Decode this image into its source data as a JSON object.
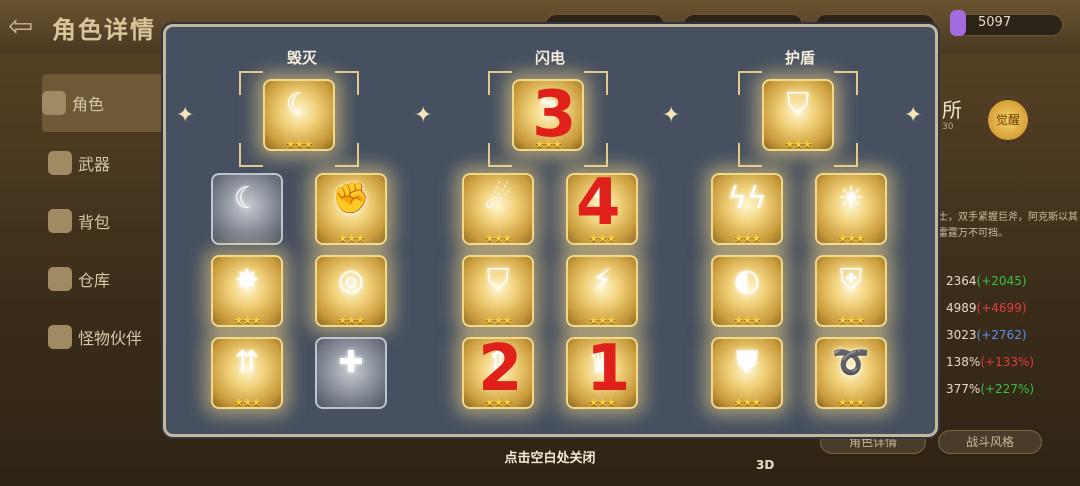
{
  "header": {
    "back_icon": "back-arrow-icon",
    "title": "角色详情",
    "gem_count": "5097"
  },
  "sidebar": {
    "items": [
      {
        "label": "角色",
        "icon": "character-icon"
      },
      {
        "label": "武器",
        "icon": "sword-icon"
      },
      {
        "label": "背包",
        "icon": "bag-icon"
      },
      {
        "label": "仓库",
        "icon": "warehouse-icon"
      },
      {
        "label": "怪物伙伴",
        "icon": "monster-icon"
      }
    ]
  },
  "right_panel": {
    "title_fragment": "所",
    "badge": "觉醒",
    "level_fragment": "30",
    "desc": "士，双手紧握巨斧，阿克斯以其雷霆万不可挡。",
    "stats": [
      {
        "base": "2364",
        "delta": "(+2045)",
        "tone": "plus"
      },
      {
        "base": "4989",
        "delta": "(+4699)",
        "tone": "minus"
      },
      {
        "base": "3023",
        "delta": "(+2762)",
        "tone": "blue"
      },
      {
        "base": "138%",
        "delta": "(+133%)",
        "tone": "minus"
      },
      {
        "base": "377%",
        "delta": "(+227%)",
        "tone": "plus"
      }
    ],
    "btn_details": "角色详情",
    "btn_style": "战斗风格",
    "label_3d": "3D"
  },
  "modal": {
    "columns": [
      {
        "title": "毁灭",
        "big_stars": "★★★"
      },
      {
        "title": "闪电",
        "big_stars": "★★★"
      },
      {
        "title": "护盾",
        "big_stars": "★★★"
      }
    ],
    "stars": "★★★",
    "annotations": [
      "3",
      "4",
      "2",
      "1"
    ],
    "close_hint": "点击空白处关闭"
  }
}
